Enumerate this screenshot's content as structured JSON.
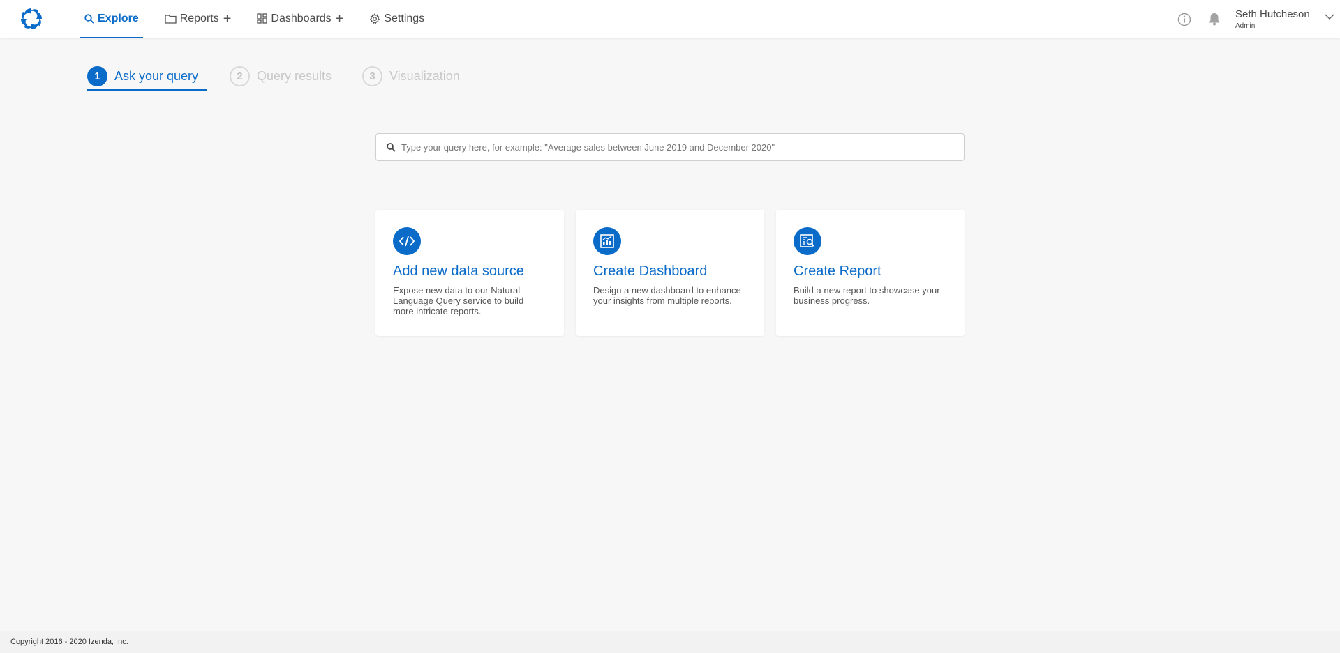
{
  "nav": {
    "items": [
      {
        "label": "Explore",
        "icon": "search-icon",
        "active": true
      },
      {
        "label": "Reports",
        "icon": "folder-icon",
        "has_add": true
      },
      {
        "label": "Dashboards",
        "icon": "dashboard-icon",
        "has_add": true
      },
      {
        "label": "Settings",
        "icon": "gear-icon"
      }
    ],
    "add_symbol": "+"
  },
  "user": {
    "name": "Seth Hutcheson",
    "role": "Admin"
  },
  "steps": [
    {
      "num": "1",
      "label": "Ask your query",
      "active": true
    },
    {
      "num": "2",
      "label": "Query results",
      "active": false
    },
    {
      "num": "3",
      "label": "Visualization",
      "active": false
    }
  ],
  "search": {
    "placeholder": "Type your query here, for example: \"Average sales between June 2019 and December 2020\"",
    "value": ""
  },
  "cards": [
    {
      "title": "Add new data source",
      "description": "Expose new data to our Natural Language Query service to build more intricate reports.",
      "icon": "code-icon"
    },
    {
      "title": "Create Dashboard",
      "description": "Design a new dashboard to enhance your insights from multiple reports.",
      "icon": "chart-board-icon"
    },
    {
      "title": "Create Report",
      "description": "Build a new report to showcase your business progress.",
      "icon": "report-search-icon"
    }
  ],
  "footer": {
    "copyright": "Copyright 2016 - 2020 Izenda, Inc."
  },
  "colors": {
    "accent": "#0b6bc9",
    "inactive_step": "#c8c8c8",
    "background": "#f7f7f7"
  }
}
